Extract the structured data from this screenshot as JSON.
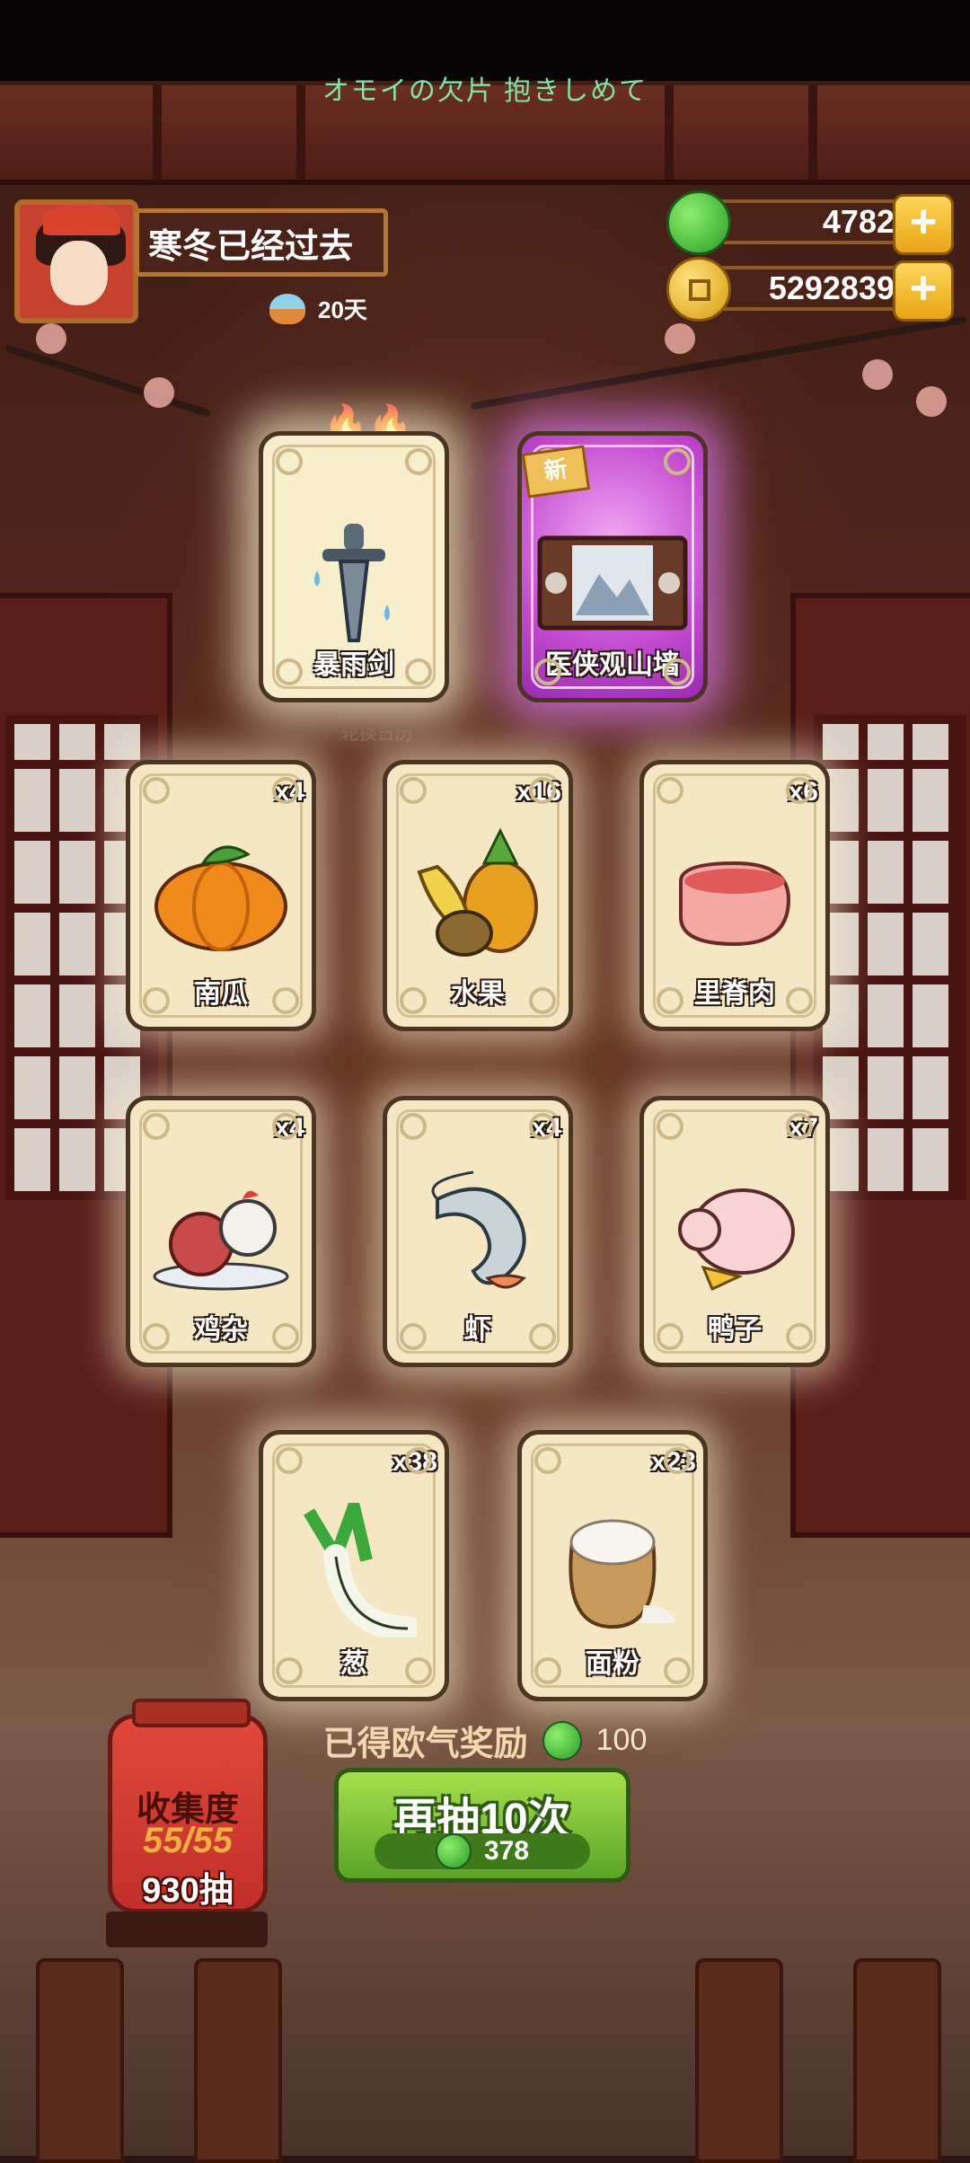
{
  "top_banner": "オモイの欠片 抱きしめて",
  "player": {
    "name": "寒冬已经过去",
    "days": "20天"
  },
  "currency": {
    "jade": "4782",
    "coins": "5292839"
  },
  "rare_cards": [
    {
      "name": "暴雨剑"
    },
    {
      "name": "医侠观山墙",
      "tag": "新"
    }
  ],
  "calendar_label": "轮换日历",
  "cards": [
    {
      "name": "南瓜",
      "count": "x4"
    },
    {
      "name": "水果",
      "count": "x16"
    },
    {
      "name": "里脊肉",
      "count": "x6"
    },
    {
      "name": "鸡杂",
      "count": "x4"
    },
    {
      "name": "虾",
      "count": "x4"
    },
    {
      "name": "鸭子",
      "count": "x7"
    },
    {
      "name": "葱",
      "count": "x38"
    },
    {
      "name": "面粉",
      "count": "x23"
    }
  ],
  "reward": {
    "label": "已得欧气奖励",
    "amount": "100"
  },
  "draw_button": {
    "label": "再抽10次",
    "cost": "378"
  },
  "collection": {
    "title": "收集度",
    "progress": "55/55",
    "draws": "930抽"
  },
  "colors": {
    "green_button": "#7cc23a",
    "card_bg": "#f5e6c4",
    "lantern": "#d23a2e",
    "banner_text": "#7fe6a8"
  },
  "icons": [
    "plus-icon",
    "jade-coin-icon",
    "gold-coin-icon",
    "flame-icon",
    "bowl-icon"
  ]
}
